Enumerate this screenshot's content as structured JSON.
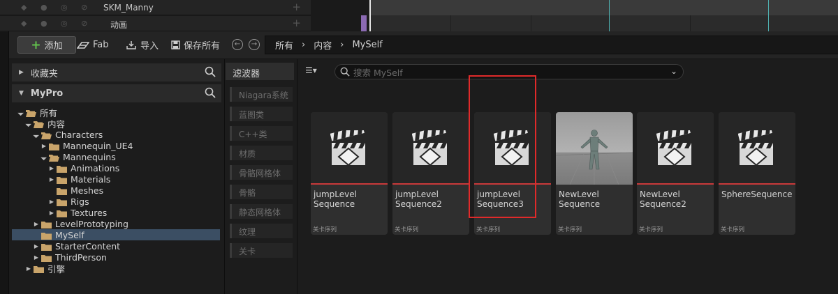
{
  "background": {
    "row1_label": "SKM_Manny",
    "row2_label": "动画"
  },
  "toolbar": {
    "add_label": "添加",
    "fab_label": "Fab",
    "import_label": "导入",
    "save_all_label": "保存所有"
  },
  "breadcrumb": [
    "所有",
    "内容",
    "MySelf"
  ],
  "favorites": {
    "label": "收藏夹"
  },
  "project": {
    "label": "MyPro"
  },
  "tree": [
    {
      "label": "所有",
      "depth": 0,
      "expanded": true
    },
    {
      "label": "内容",
      "depth": 1,
      "expanded": true
    },
    {
      "label": "Characters",
      "depth": 2,
      "expanded": true
    },
    {
      "label": "Mannequin_UE4",
      "depth": 3,
      "expanded": false
    },
    {
      "label": "Mannequins",
      "depth": 3,
      "expanded": true
    },
    {
      "label": "Animations",
      "depth": 4,
      "expanded": false
    },
    {
      "label": "Materials",
      "depth": 4,
      "expanded": false
    },
    {
      "label": "Meshes",
      "depth": 4,
      "expanded": null
    },
    {
      "label": "Rigs",
      "depth": 4,
      "expanded": false
    },
    {
      "label": "Textures",
      "depth": 4,
      "expanded": false
    },
    {
      "label": "LevelPrototyping",
      "depth": 2,
      "expanded": false
    },
    {
      "label": "MySelf",
      "depth": 2,
      "expanded": null,
      "selected": true
    },
    {
      "label": "StarterContent",
      "depth": 2,
      "expanded": false
    },
    {
      "label": "ThirdPerson",
      "depth": 2,
      "expanded": false
    },
    {
      "label": "引擎",
      "depth": 1,
      "expanded": false
    }
  ],
  "filters": {
    "title": "滤波器",
    "items": [
      "Niagara系统",
      "蓝图类",
      "C++类",
      "材质",
      "骨骼网格体",
      "骨骼",
      "静态网格体",
      "纹理",
      "关卡"
    ]
  },
  "search": {
    "placeholder": "搜索 MySelf"
  },
  "assets": [
    {
      "name": "jumpLevel\nSequence",
      "type": "关卡序列",
      "thumb": "clapper-icon"
    },
    {
      "name": "jumpLevel\nSequence2",
      "type": "关卡序列",
      "thumb": "clapper-icon"
    },
    {
      "name": "jumpLevel\nSequence3",
      "type": "关卡序列",
      "thumb": "clapper-icon"
    },
    {
      "name": "NewLevel\nSequence",
      "type": "关卡序列",
      "thumb": "mannequin-preview"
    },
    {
      "name": "NewLevel\nSequence2",
      "type": "关卡序列",
      "thumb": "clapper-icon"
    },
    {
      "name": "SphereSequence",
      "type": "关卡序列",
      "thumb": "clapper-icon"
    }
  ],
  "colors": {
    "accent_red": "#c9393a",
    "selection": "#3b4e63",
    "add_plus": "#62c24d",
    "folder": "#c9a46a"
  }
}
